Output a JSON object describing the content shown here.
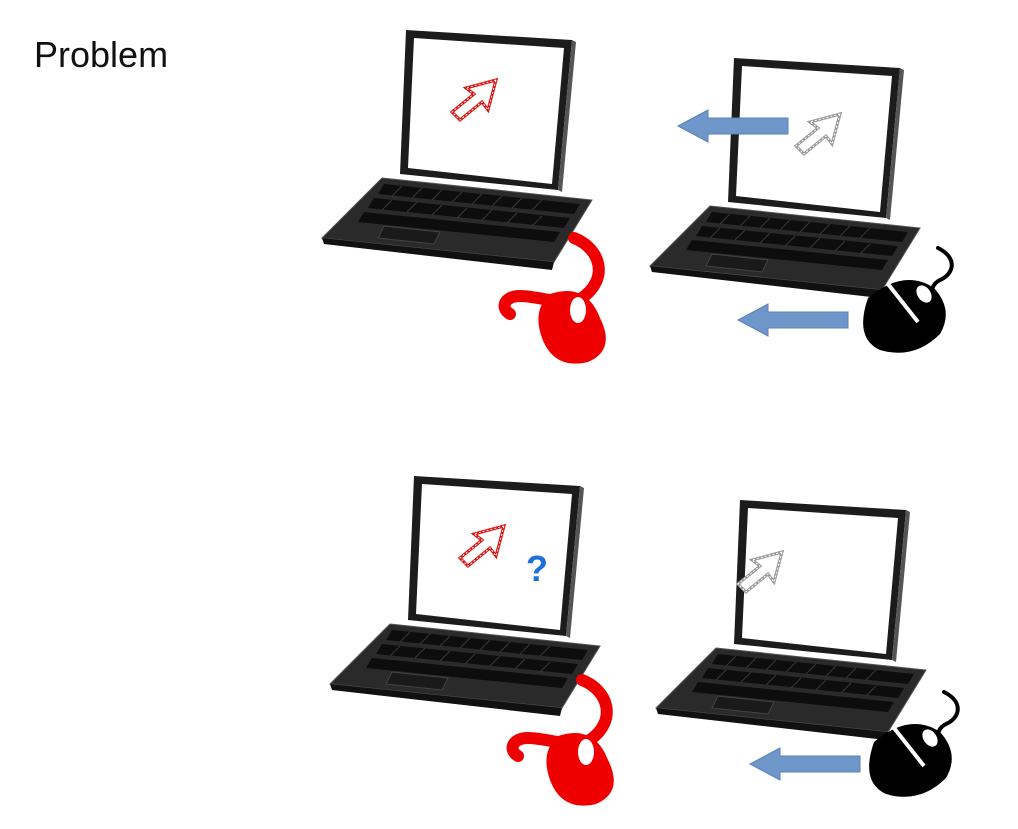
{
  "title": "Problem",
  "question_mark": "?",
  "colors": {
    "local_pointer": "#e01010",
    "remote_pointer": "#9a9a9a",
    "local_mouse": "#ee0000",
    "remote_mouse": "#000000",
    "arrow_fill": "#6e96c8",
    "question": "#1e6fd9"
  },
  "icons": [
    "laptop-icon",
    "mouse-pointer-icon",
    "mouse-icon",
    "arrow-left-icon"
  ],
  "scenarios": [
    {
      "local": {
        "laptop": "laptop-icon",
        "pointer": "mouse-pointer-icon",
        "mouse": "mouse-icon"
      },
      "remote": {
        "laptop": "laptop-icon",
        "pointer": "mouse-pointer-icon",
        "mouse": "mouse-icon",
        "pointer_moves_left": true,
        "mouse_moves_left": true
      }
    },
    {
      "local": {
        "laptop": "laptop-icon",
        "pointer": "mouse-pointer-icon",
        "mouse": "mouse-icon",
        "confused": true
      },
      "remote": {
        "laptop": "laptop-icon",
        "pointer": "mouse-pointer-icon",
        "mouse": "mouse-icon",
        "mouse_moves_left": true
      }
    }
  ]
}
